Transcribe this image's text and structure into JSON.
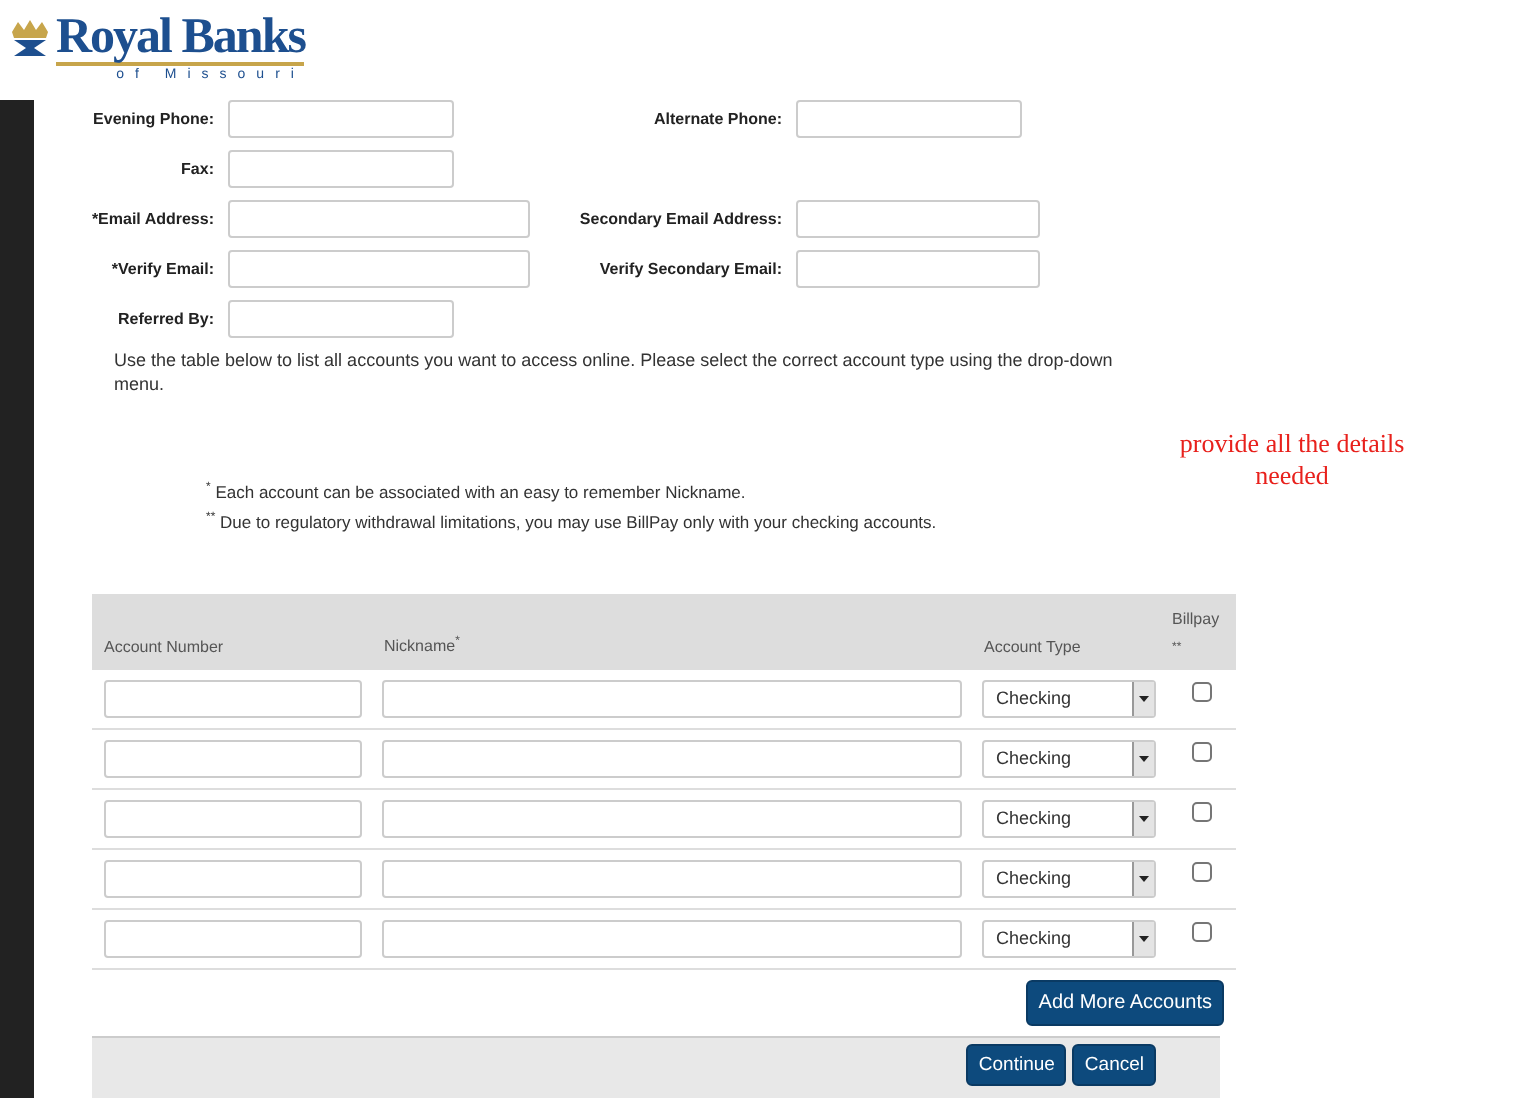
{
  "logo": {
    "name": "Royal Banks",
    "tagline": "of Missouri"
  },
  "form_rows": [
    {
      "left": {
        "label": "Evening Phone:"
      },
      "right": {
        "label": "Alternate Phone:"
      }
    },
    {
      "left": {
        "label": "Fax:"
      }
    },
    {
      "left": {
        "label": "*Email Address:"
      },
      "right": {
        "label": "Secondary Email Address:"
      }
    },
    {
      "left": {
        "label": "*Verify Email:"
      },
      "right": {
        "label": "Verify Secondary Email:"
      }
    },
    {
      "left": {
        "label": "Referred By:"
      }
    }
  ],
  "instructions": "Use the table below to list all accounts you want to access online. Please select the correct account type using the drop-down menu.",
  "annotation": "provide all the details needed",
  "notes": [
    "$^{*}$ Each account can be associated with an easy to remember Nickname.",
    "$^{**}$ Due to regulatory withdrawal limitations, you may use BillPay only with your checking accounts."
  ],
  "accounts_table": {
    "columns": [
      "Account Number",
      "Nickname$^{*}$",
      "Account Type",
      "Billpay $^{**}$"
    ],
    "rows": [
      {
        "account_type": "Checking",
        "billpay": false
      },
      {
        "account_type": "Checking",
        "billpay": false
      },
      {
        "account_type": "Checking",
        "billpay": false
      },
      {
        "account_type": "Checking",
        "billpay": false
      },
      {
        "account_type": "Checking",
        "billpay": false
      }
    ]
  },
  "add_button": "Add More Accounts",
  "buttons": [
    "Continue",
    "Cancel"
  ]
}
